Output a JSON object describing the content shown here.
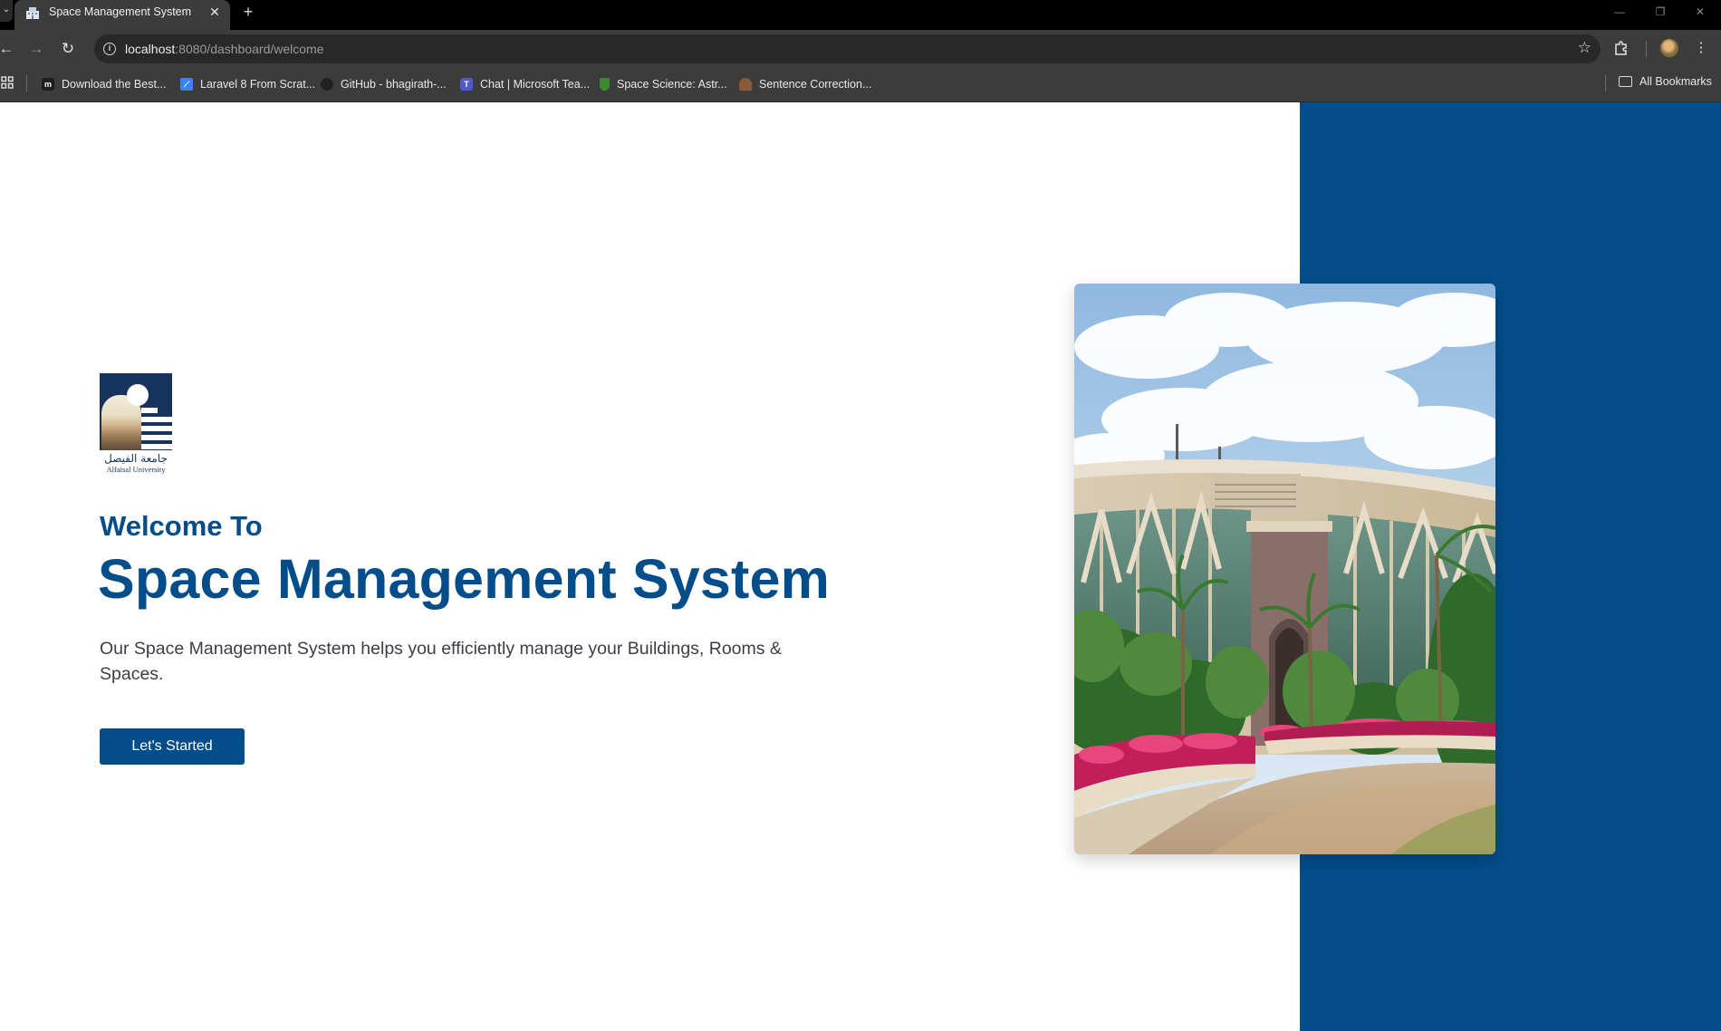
{
  "browser": {
    "tab": {
      "title": "Space Management System",
      "favicon": "building-icon"
    },
    "new_tab": "+",
    "window_controls": {
      "minimize": "—",
      "restore": "❐",
      "close": "✕"
    },
    "url": {
      "host": "localhost",
      "path": ":8080/dashboard/welcome"
    },
    "bookmarks": [
      {
        "label": "Download the Best...",
        "icon": "m-icon",
        "color": "#1e1e1e"
      },
      {
        "label": "Laravel 8 From Scrat...",
        "icon": "laravel-icon",
        "color": "#3b82f6"
      },
      {
        "label": "GitHub - bhagirath-...",
        "icon": "github-icon",
        "color": "#222222"
      },
      {
        "label": "Chat | Microsoft Tea...",
        "icon": "teams-icon",
        "color": "#5059c9"
      },
      {
        "label": "Space Science: Astr...",
        "icon": "shield-icon",
        "color": "#3c8a2e"
      },
      {
        "label": "Sentence Correction...",
        "icon": "person-icon",
        "color": "#8a5a3a"
      }
    ],
    "all_bookmarks": "All Bookmarks"
  },
  "logo": {
    "arabic": "جامعة الفيصل",
    "english": "Alfaisal University"
  },
  "hero": {
    "welcome": "Welcome To",
    "title": "Space Management System",
    "description": "Our Space Management System helps you efficiently manage your Buildings, Rooms & Spaces.",
    "cta": "Let's Started"
  },
  "colors": {
    "primary": "#034d8a",
    "text": "#3d3d4a",
    "background": "#ffffff"
  }
}
